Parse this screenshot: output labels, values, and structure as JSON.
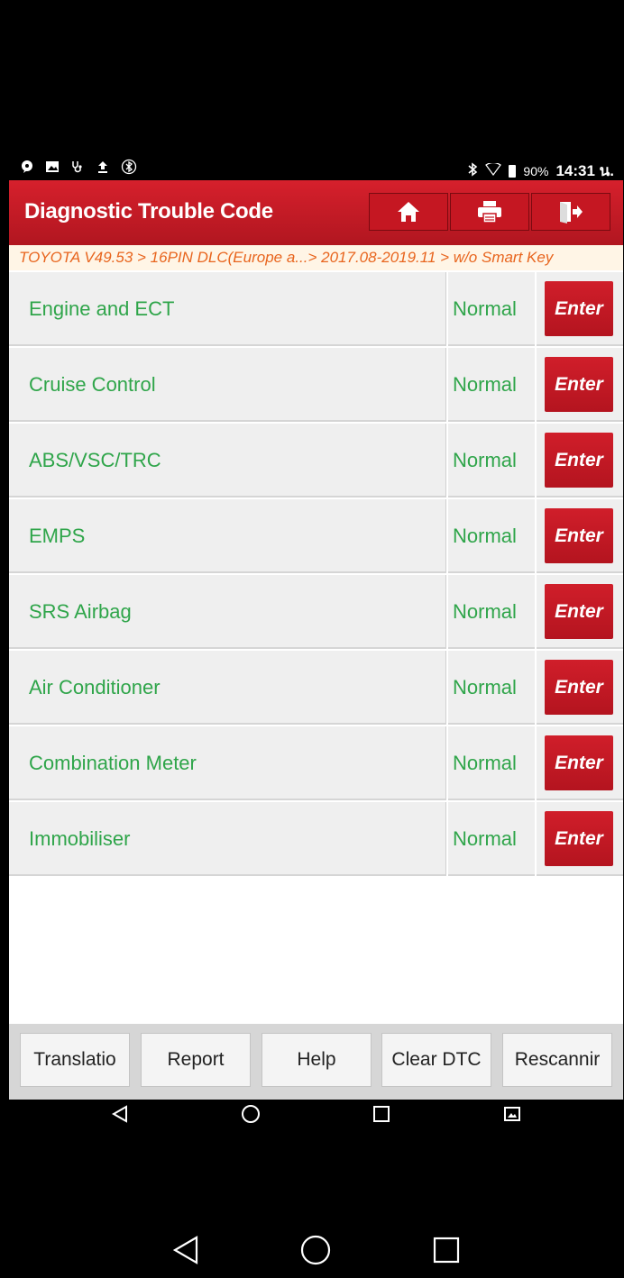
{
  "status_bar": {
    "left_icons": [
      "chat-icon",
      "image-icon",
      "stethoscope-icon",
      "upload-icon",
      "bluetooth-circle-icon"
    ],
    "right_icons": [
      "bluetooth-icon",
      "wifi-icon",
      "battery-icon"
    ],
    "battery": "90%",
    "time": "14:31 น."
  },
  "header": {
    "title": "Diagnostic Trouble Code",
    "buttons": [
      "home-icon",
      "print-icon",
      "exit-icon"
    ]
  },
  "breadcrumb": "TOYOTA V49.53 > 16PIN DLC(Europe a...> 2017.08-2019.11 > w/o Smart Key",
  "systems": [
    {
      "name": "Engine and ECT",
      "status": "Normal",
      "action": "Enter"
    },
    {
      "name": "Cruise Control",
      "status": "Normal",
      "action": "Enter"
    },
    {
      "name": "ABS/VSC/TRC",
      "status": "Normal",
      "action": "Enter"
    },
    {
      "name": "EMPS",
      "status": "Normal",
      "action": "Enter"
    },
    {
      "name": "SRS Airbag",
      "status": "Normal",
      "action": "Enter"
    },
    {
      "name": "Air Conditioner",
      "status": "Normal",
      "action": "Enter"
    },
    {
      "name": "Combination Meter",
      "status": "Normal",
      "action": "Enter"
    },
    {
      "name": "Immobiliser",
      "status": "Normal",
      "action": "Enter"
    }
  ],
  "toolbar": {
    "translation": "Translatio",
    "report": "Report",
    "help": "Help",
    "clear_dtc": "Clear DTC",
    "rescan": "Rescannir"
  },
  "colors": {
    "header_red": "#c8192a",
    "status_green": "#2fa54a",
    "breadcrumb_orange": "#e8651e"
  }
}
